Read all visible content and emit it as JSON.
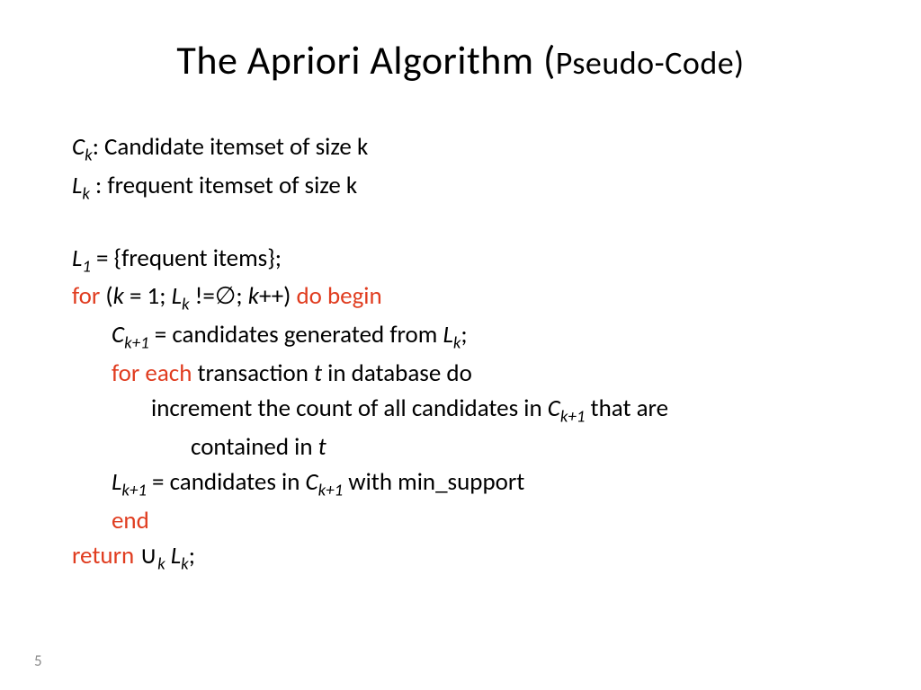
{
  "title": {
    "main": "The Apriori Algorithm (",
    "sub": "Pseudo-Code)"
  },
  "defs": {
    "ck_sym": "C",
    "ck_sub": "k",
    "ck_text": ": Candidate itemset of size k",
    "lk_sym": "L",
    "lk_sub": "k",
    "lk_text": " : frequent itemset of size k"
  },
  "code": {
    "l1_sym": "L",
    "l1_sub": "1",
    "l1_rest": " = {frequent items};",
    "for_kw": "for",
    "for_open": " (",
    "for_k": "k",
    "for_eq1": " = 1; ",
    "for_Lk_sym": "L",
    "for_Lk_sub": "k",
    "for_ne": " !=",
    "for_empty": "∅",
    "for_semi": "; ",
    "for_kpp": "k",
    "for_pp": "++) ",
    "do_begin": "do begin",
    "ck1_sym": "C",
    "ck1_sub": "k+1",
    "ck1_eq": " = candidates generated from ",
    "ck1_Lk_sym": "L",
    "ck1_Lk_sub": "k",
    "ck1_end": ";",
    "foreach_kw": "for each",
    "foreach_mid": " transaction ",
    "foreach_t": "t",
    "foreach_rest": " in database do",
    "incr_a": "increment the count of all candidates in ",
    "incr_C": "C",
    "incr_Csub": "k+1",
    "incr_b": " that are",
    "incr_c": "contained in ",
    "incr_t": "t",
    "lk1_sym": "L",
    "lk1_sub": "k+1",
    "lk1_mid": "  = candidates in ",
    "lk1_C": "C",
    "lk1_Csub": "k+1",
    "lk1_rest": " with min_support",
    "end_kw": "end",
    "return_kw": "return",
    "ret_sp": " ",
    "ret_union": "∪",
    "ret_usub": "k",
    "ret_sp2": " ",
    "ret_L": "L",
    "ret_Lsub": "k",
    "ret_end": ";"
  },
  "page_number": "5"
}
